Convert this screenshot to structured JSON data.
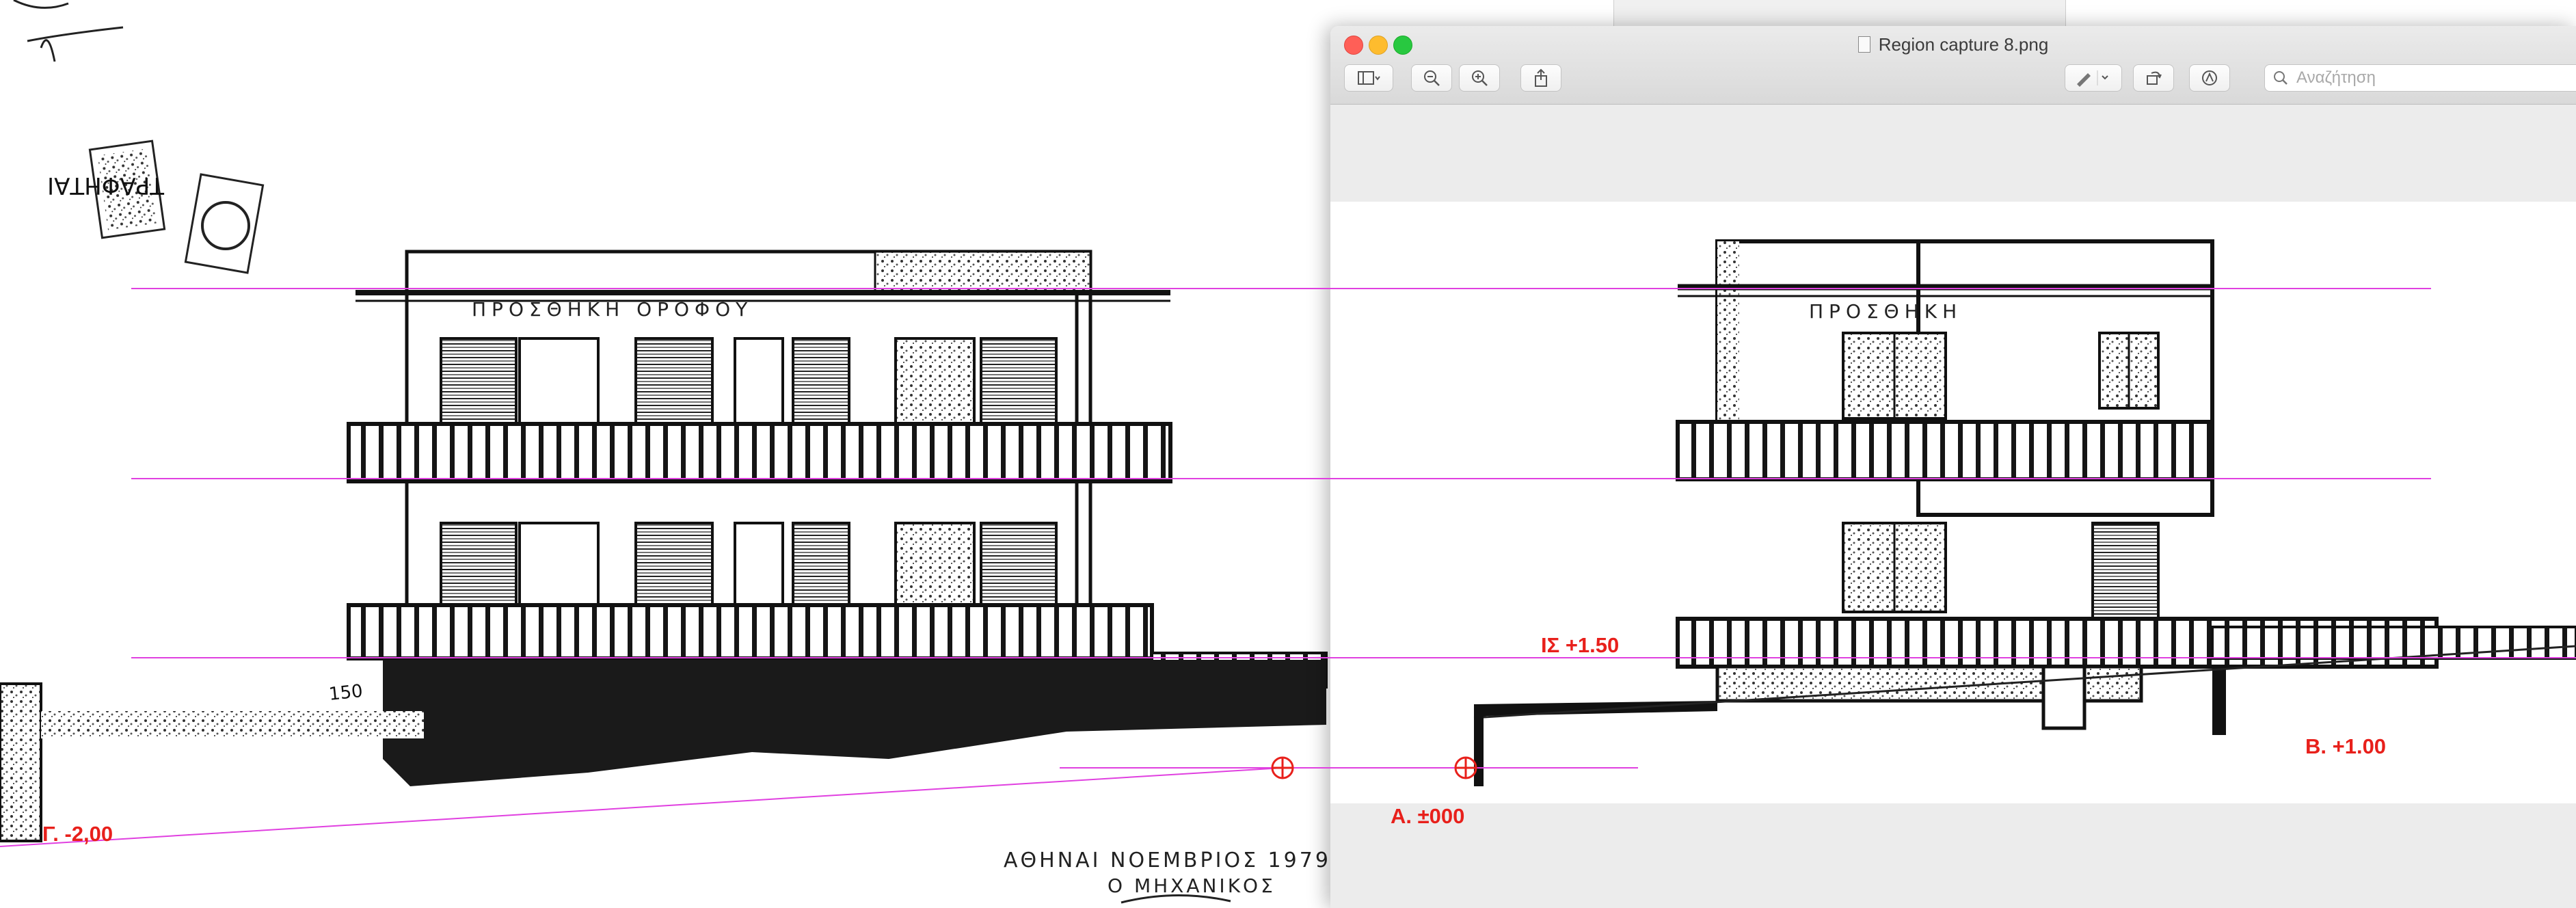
{
  "window": {
    "title": "Region capture 8.png",
    "search_placeholder": "Αναζήτηση"
  },
  "drawing_left": {
    "title_text": "ΠΡΟΣΘΗΚΗ ΟΡΟΦΟΥ",
    "date_text": "ΑΘΗΝΑΙ ΝΟΕΜΒΡΙΟΣ 1979",
    "engineer_text": "Ο ΜΗΧΑΝΙΚΟΣ",
    "stamp_text": "ΤΡΑΦΗΤΑΙ",
    "dimension_text": "150"
  },
  "drawing_right": {
    "title_text": "ΠΡΟΣΘΗΚΗ"
  },
  "annotations": {
    "is_level": "ΙΣ +1.50",
    "a_level": "Α. ±000",
    "b_level": "Β. +1.00",
    "g_level": "Γ. -2,00"
  },
  "colors": {
    "guide_line": "#e040e0",
    "annotation": "#e8201b",
    "ink": "#111111"
  },
  "icons": [
    "sidebar-icon",
    "chevron-down-icon",
    "zoom-out-icon",
    "zoom-in-icon",
    "share-icon",
    "pen-icon",
    "chevron-down-icon",
    "rotate-icon",
    "markup-icon",
    "search-icon"
  ]
}
